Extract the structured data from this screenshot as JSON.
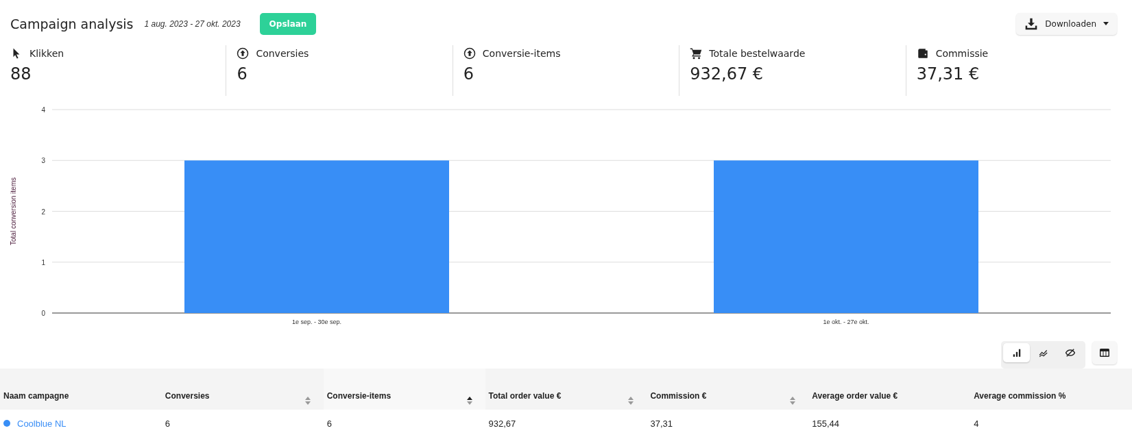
{
  "header": {
    "title": "Campaign analysis",
    "date_range": "1 aug. 2023 - 27 okt. 2023",
    "save_button": "Opslaan",
    "download_button": "Downloaden"
  },
  "stats": [
    {
      "kind": "pointer",
      "label": "Klikken",
      "value": "88"
    },
    {
      "kind": "upload",
      "label": "Conversies",
      "value": "6"
    },
    {
      "kind": "upload",
      "label": "Conversie-items",
      "value": "6"
    },
    {
      "kind": "cart",
      "label": "Totale bestelwaarde",
      "value": "932,67 €"
    },
    {
      "kind": "wallet",
      "label": "Commissie",
      "value": "37,31 €"
    }
  ],
  "chart_data": {
    "type": "bar",
    "ylabel": "Total conversion items",
    "categories": [
      "1e sep. - 30e sep.",
      "1e okt. - 27e okt."
    ],
    "series": [
      {
        "color": "#388ef6",
        "values": [
          3,
          3
        ]
      }
    ],
    "grid": true,
    "ylim": [
      0,
      4
    ],
    "yticks": [
      0,
      1,
      2,
      3,
      4
    ]
  },
  "view_modes": [
    {
      "kind": "bar",
      "selected": true
    },
    {
      "kind": "line",
      "selected": false
    },
    {
      "kind": "hidden",
      "selected": false
    }
  ],
  "table": {
    "columns": [
      {
        "label": "Naam campagne"
      },
      {
        "label": "Conversies",
        "sortable": true,
        "sorted": false
      },
      {
        "label": "Conversie-items",
        "sortable": true,
        "sorted": true
      },
      {
        "label": "Total order value €",
        "sortable": true,
        "sorted": false
      },
      {
        "label": "Commission €",
        "sortable": true,
        "sorted": false
      },
      {
        "label": "Average order value €"
      },
      {
        "label": "Average commission %"
      }
    ],
    "rows": [
      {
        "color": "#388ef6",
        "cells": [
          "Coolblue NL",
          "6",
          "6",
          "932,67",
          "37,31",
          "155,44",
          "4"
        ]
      }
    ]
  }
}
